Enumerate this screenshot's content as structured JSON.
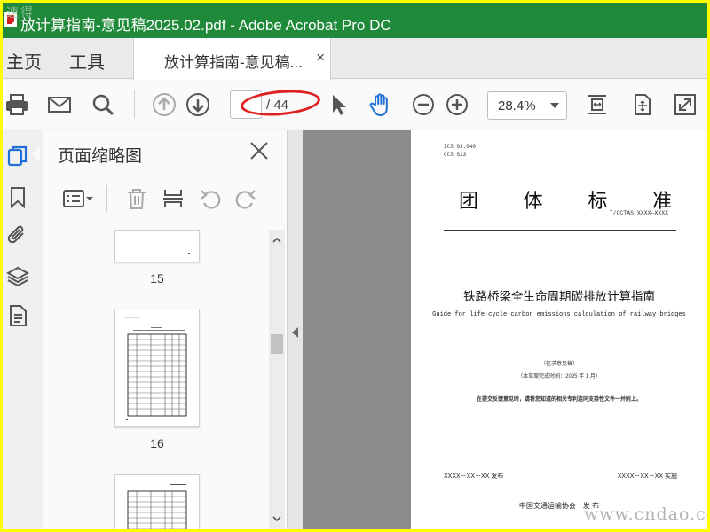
{
  "window": {
    "title": "放计算指南-意见稿2025.02.pdf - Adobe Acrobat Pro DC",
    "corner_watermark": "速得"
  },
  "menubar": {
    "home": "主页",
    "tools": "工具",
    "tab_label": "放计算指南-意见稿...",
    "tab_close": "×"
  },
  "toolbar": {
    "current_page": "",
    "page_total": "/ 44",
    "zoom": "28.4%",
    "icons": [
      "print-icon",
      "mail-icon",
      "search-icon",
      "page-up-icon",
      "page-down-icon",
      "select-arrow-icon",
      "hand-icon",
      "zoom-out-icon",
      "zoom-in-icon",
      "fit-page-icon",
      "scrolling-mode-icon",
      "fullscreen-icon"
    ]
  },
  "rail": {
    "icons": [
      "page-thumbnails-icon",
      "bookmarks-icon",
      "attachments-icon",
      "layers-icon",
      "content-icon"
    ]
  },
  "panel": {
    "title": "页面缩略图",
    "close": "×",
    "tools": [
      "options-icon",
      "delete-icon",
      "insert-page-icon",
      "undo-icon",
      "redo-icon"
    ],
    "thumbnails": [
      {
        "number": "15"
      },
      {
        "number": "16"
      },
      {
        "number": ""
      }
    ]
  },
  "document": {
    "meta_line1": "ICS 93.040",
    "meta_line2": "CCS S13",
    "big_title": [
      "团",
      "体",
      "标",
      "准"
    ],
    "standard_no": "T/CCTAS XXXX—XXXX",
    "cn_title": "铁路桥梁全生命周期碳排放计算指南",
    "en_title": "Guide for life cycle carbon emissions calculation of railway bridges",
    "draft": "（征求意见稿）",
    "finish_date": "（本草案完成时间：2025 年 1 月）",
    "notice": "在提交反馈意见时，请将您知道的相关专利连同支持性文件一并附上。",
    "issue_date": "XXXX－XX－XX 发布",
    "implement_date": "XXXX－XX－XX 实施",
    "publisher": "中国交通运输协会　发 布"
  },
  "site_watermark": "www.cndao.com",
  "colors": {
    "titlebar": "#1f8a3a",
    "accent_blue": "#1f6fd6",
    "annotation_red": "#e02020"
  }
}
